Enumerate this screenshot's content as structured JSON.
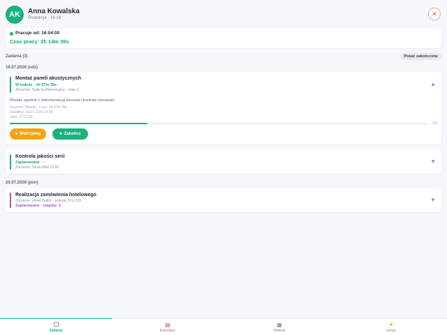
{
  "user": {
    "initials": "AK",
    "name": "Anna Kowalska",
    "subtitle": "Produkcja · 16:16"
  },
  "work": {
    "since": "Pracuje od: 16:04:00",
    "duration": "Czas pracy: 2h 14m 39s"
  },
  "tasks_header": {
    "title": "Zadania (3)",
    "show_done_label": "Pokaż zakończone"
  },
  "dates": [
    "19.07.2026 (ndz)",
    "20.07.2026 (pon)"
  ],
  "tasks": [
    {
      "title": "Montaż paneli akustycznych",
      "status": "W trakcie · 1h 57m 39s",
      "order": "Zlecenie: Sala konferencyjna - etap 2",
      "description": "Montaż zgodnie z dokumentacją zlecenia i kontrola mocowań.",
      "priority": "Priorytet: Wysoki · Czas: 1h 57m 39s",
      "deadline": "Deadline: 19.07.2026 14:00",
      "start": "Start: 17:23:00",
      "progress": 0.33,
      "progress_text": "1/3",
      "pause_label": "Wstrzymaj",
      "finish_label": "Zakończ",
      "accent": "#16b37a",
      "status_color": "#16a673"
    },
    {
      "title": "Kontrola jakości serii",
      "status": "Zaplanowane · -",
      "order": "Zlecenie: Seria MW-0726",
      "accent": "#16b37a",
      "status_color": "#16a673"
    },
    {
      "title": "Realizacja zamówienia hotelowego",
      "order": "Zlecenie: Hotel Baltic - pokoje 201-220",
      "status": "Zaplanowane · etapów: 2",
      "accent": "#9b59c6",
      "status_color": "#9b59c6"
    }
  ],
  "nav": [
    {
      "label": "Zadania",
      "icon": "tasks-icon",
      "active": true
    },
    {
      "label": "Kalendarz",
      "icon": "calendar-icon",
      "active": false
    },
    {
      "label": "Historia",
      "icon": "history-icon",
      "active": false
    },
    {
      "label": "Urlopy",
      "icon": "vacation-icon",
      "active": false
    }
  ],
  "colors": {
    "accent": "#16b37a",
    "warning": "#f2a413",
    "danger": "#e05a5a",
    "purple": "#9b59c6"
  }
}
